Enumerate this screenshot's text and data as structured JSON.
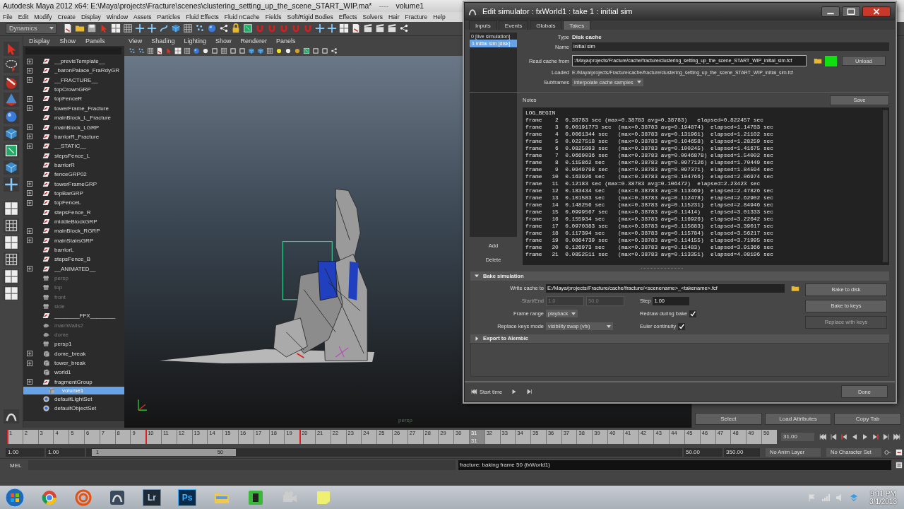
{
  "window": {
    "title": "Autodesk Maya 2012 x64: E:\\Maya\\projects\\Fracture\\scenes\\clustering_setting_up_the_scene_START_WIP.ma*",
    "separator": "----",
    "subtitle": "volume1"
  },
  "menu": [
    "File",
    "Edit",
    "Modify",
    "Create",
    "Display",
    "Window",
    "Assets",
    "Particles",
    "Fluid Effects",
    "Fluid nCache",
    "Fields",
    "Soft/Rigid Bodies",
    "Effects",
    "Solvers",
    "Hair",
    "Fracture",
    "Help"
  ],
  "shelf": {
    "menu_set": "Dynamics"
  },
  "outliner": {
    "menu": [
      "Display",
      "Show",
      "Panels"
    ],
    "items": [
      {
        "name": "__previsTemplate__",
        "kind": "transform",
        "expandable": true,
        "hidden": false,
        "selected": false
      },
      {
        "name": "_baronPalace_FraRdyGR",
        "kind": "transform",
        "expandable": true,
        "hidden": false,
        "selected": false
      },
      {
        "name": "__FRACTURE__",
        "kind": "transform",
        "expandable": true,
        "hidden": false,
        "selected": false
      },
      {
        "name": "topCrownGRP",
        "kind": "transform",
        "expandable": false,
        "hidden": false,
        "selected": false
      },
      {
        "name": "topFenceR",
        "kind": "transform",
        "expandable": true,
        "hidden": false,
        "selected": false
      },
      {
        "name": "towerFrame_Fracture",
        "kind": "transform",
        "expandable": true,
        "hidden": false,
        "selected": false
      },
      {
        "name": "mainBlock_L_Fracture",
        "kind": "transform",
        "expandable": false,
        "hidden": false,
        "selected": false
      },
      {
        "name": "mainBlock_LGRP",
        "kind": "transform",
        "expandable": true,
        "hidden": false,
        "selected": false
      },
      {
        "name": "barriorR_Fracture",
        "kind": "transform",
        "expandable": true,
        "hidden": false,
        "selected": false
      },
      {
        "name": "__STATIC__",
        "kind": "transform",
        "expandable": true,
        "hidden": false,
        "selected": false
      },
      {
        "name": "stepsFence_L",
        "kind": "transform",
        "expandable": false,
        "hidden": false,
        "selected": false
      },
      {
        "name": "barriorR",
        "kind": "transform",
        "expandable": false,
        "hidden": false,
        "selected": false
      },
      {
        "name": "fenceGRP02",
        "kind": "transform",
        "expandable": false,
        "hidden": false,
        "selected": false
      },
      {
        "name": "towerFrameGRP",
        "kind": "transform",
        "expandable": true,
        "hidden": false,
        "selected": false
      },
      {
        "name": "topBarGRP",
        "kind": "transform",
        "expandable": true,
        "hidden": false,
        "selected": false
      },
      {
        "name": "topFenceL",
        "kind": "transform",
        "expandable": true,
        "hidden": false,
        "selected": false
      },
      {
        "name": "stepsFence_R",
        "kind": "transform",
        "expandable": false,
        "hidden": false,
        "selected": false
      },
      {
        "name": "middleBlockGRP",
        "kind": "transform",
        "expandable": false,
        "hidden": false,
        "selected": false
      },
      {
        "name": "mainBlock_RGRP",
        "kind": "transform",
        "expandable": true,
        "hidden": false,
        "selected": false
      },
      {
        "name": "mainStairsGRP",
        "kind": "transform",
        "expandable": true,
        "hidden": false,
        "selected": false
      },
      {
        "name": "barriorL",
        "kind": "transform",
        "expandable": false,
        "hidden": false,
        "selected": false
      },
      {
        "name": "stepsFence_B",
        "kind": "transform",
        "expandable": false,
        "hidden": false,
        "selected": false
      },
      {
        "name": "__ANIMATED__",
        "kind": "transform",
        "expandable": true,
        "hidden": false,
        "selected": false
      },
      {
        "name": "persp",
        "kind": "camera",
        "expandable": false,
        "hidden": true,
        "selected": false
      },
      {
        "name": "top",
        "kind": "camera",
        "expandable": false,
        "hidden": true,
        "selected": false
      },
      {
        "name": "front",
        "kind": "camera",
        "expandable": false,
        "hidden": true,
        "selected": false
      },
      {
        "name": "side",
        "kind": "camera",
        "expandable": false,
        "hidden": true,
        "selected": false
      },
      {
        "name": "________FFX________",
        "kind": "transform",
        "expandable": false,
        "hidden": false,
        "selected": false
      },
      {
        "name": "mainWalls2",
        "kind": "mesh",
        "expandable": false,
        "hidden": true,
        "selected": false
      },
      {
        "name": "dome",
        "kind": "mesh",
        "expandable": false,
        "hidden": true,
        "selected": false
      },
      {
        "name": "persp1",
        "kind": "camera",
        "expandable": false,
        "hidden": false,
        "selected": false
      },
      {
        "name": "dome_break",
        "kind": "group",
        "expandable": true,
        "hidden": false,
        "selected": false
      },
      {
        "name": "tower_break",
        "kind": "group",
        "expandable": true,
        "hidden": false,
        "selected": false
      },
      {
        "name": "world1",
        "kind": "group",
        "expandable": false,
        "hidden": false,
        "selected": false
      },
      {
        "name": "fragmentGroup",
        "kind": "transform",
        "expandable": true,
        "hidden": false,
        "selected": false
      },
      {
        "name": "volume1",
        "kind": "group",
        "expandable": false,
        "hidden": false,
        "selected": true
      },
      {
        "name": "defaultLightSet",
        "kind": "set",
        "expandable": false,
        "hidden": false,
        "selected": false
      },
      {
        "name": "defaultObjectSet",
        "kind": "set",
        "expandable": false,
        "hidden": false,
        "selected": false
      }
    ]
  },
  "viewport": {
    "menu": [
      "View",
      "Shading",
      "Lighting",
      "Show",
      "Renderer",
      "Panels"
    ],
    "camera": "persp"
  },
  "channel_box_buttons": [
    "Select",
    "Load Attributes",
    "Copy Tab"
  ],
  "dialog": {
    "title": "Edit simulator : fxWorld1 : take 1 : initial sim",
    "tabs": [
      {
        "label": "Inputs",
        "selected": false
      },
      {
        "label": "Events",
        "selected": false
      },
      {
        "label": "Globals",
        "selected": false
      },
      {
        "label": "Takes",
        "selected": true
      }
    ],
    "takes": [
      {
        "label": "0 [live simulation]",
        "selected": false
      },
      {
        "label": "1 initial sim [disk]",
        "selected": true
      }
    ],
    "take_buttons": [
      "Add",
      "Delete"
    ],
    "type": {
      "label": "Type",
      "value": "Disk cache"
    },
    "name": {
      "label": "Name",
      "value": "initial sim"
    },
    "read_cache": {
      "label": "Read cache from",
      "value": ":/Maya/projects/Fracture/cache/fracture/clustering_setting_up_the_scene_START_WIP_initial_sim.fcf",
      "loaded": true,
      "unload": "Unload"
    },
    "loaded": {
      "label": "Loaded",
      "value": "E:/Maya/projects/Fracture/cache/fracture/clustering_setting_up_the_scene_START_WIP_initial_sim.fcf"
    },
    "subframes": {
      "label": "Subframes",
      "value": "interpolate cache samples"
    },
    "notes": {
      "label": "Notes",
      "save": "Save",
      "log": [
        "LOG_BEGIN",
        "frame    2  0.38783 sec (max=0.38783 avg=0.38783)   elapsed=0.822457 sec",
        "frame    3  0.00191773 sec  (max=0.38783 avg=0.194874)  elapsed=1.14783 sec",
        "frame    4  0.0061344 sec   (max=0.38783 avg=0.131961)  elapsed=1.21102 sec",
        "frame    5  0.0227518 sec   (max=0.38783 avg=0.104658)  elapsed=1.28259 sec",
        "frame    6  0.0825893 sec   (max=0.38783 avg=0.100245)  elapsed=1.41675 sec",
        "frame    7  0.0669036 sec   (max=0.38783 avg=0.0946878) elapsed=1.54002 sec",
        "frame    8  0.115862 sec    (max=0.38783 avg=0.0977126) elapsed=1.70449 sec",
        "frame    9  0.0949798 sec   (max=0.38783 avg=0.097371)  elapsed=1.84594 sec",
        "frame   10  0.163926 sec    (max=0.38783 avg=0.104766)  elapsed=2.06974 sec",
        "frame   11  0.12183 sec (max=0.38783 avg=0.106472)  elapsed=2.23423 sec",
        "frame   12  0.183434 sec    (max=0.38783 avg=0.113469)  elapsed=2.47826 sec",
        "frame   13  0.101583 sec    (max=0.38783 avg=0.112478)  elapsed=2.62902 sec",
        "frame   14  0.148256 sec    (max=0.38783 avg=0.115231)  elapsed=2.84946 sec",
        "frame   15  0.0999567 sec   (max=0.38783 avg=0.11414)   elapsed=3.01333 sec",
        "frame   16  0.155934 sec    (max=0.38783 avg=0.116926)  elapsed=3.22642 sec",
        "frame   17  0.0970383 sec   (max=0.38783 avg=0.115683)  elapsed=3.39017 sec",
        "frame   18  0.117394 sec    (max=0.38783 avg=0.115784)  elapsed=3.56217 sec",
        "frame   19  0.0864739 sec   (max=0.38783 avg=0.114155)  elapsed=3.71995 sec",
        "frame   20  0.126973 sec    (max=0.38783 avg=0.11483)   elapsed=3.91366 sec",
        "frame   21  0.0852511 sec   (max=0.38783 avg=0.113351)  elapsed=4.08196 sec"
      ]
    },
    "bake": {
      "title": "Bake simulation",
      "expanded": true,
      "write_cache": {
        "label": "Write cache to",
        "value": "E:/Maya/projects/Fracture/cache/fracture/<scenename>_<takename>.fcf"
      },
      "start_end": {
        "label": "Start/End",
        "start": "1.0",
        "end": "50.0",
        "disabled": true
      },
      "step": {
        "label": "Step",
        "value": "1.00"
      },
      "frame_range": {
        "label": "Frame range",
        "value": "playback"
      },
      "redraw": {
        "label": "Redraw during bake",
        "checked": true
      },
      "replace_keys_mode": {
        "label": "Replace keys mode",
        "value": "visibility swap (vfx)"
      },
      "euler": {
        "label": "Euler continuity",
        "checked": true
      },
      "buttons": [
        {
          "label": "Bake to disk",
          "disabled": false
        },
        {
          "label": "Bake to keys",
          "disabled": false
        },
        {
          "label": "Replace with keys",
          "disabled": true
        }
      ]
    },
    "alembic": {
      "title": "Export to Alembic",
      "expanded": false
    },
    "start_time": "Start time",
    "done": "Done"
  },
  "timeline": {
    "frames": [
      {
        "label": "1",
        "key": true,
        "selected": false
      },
      {
        "label": "2",
        "key": false,
        "selected": false
      },
      {
        "label": "3",
        "key": false,
        "selected": false
      },
      {
        "label": "4",
        "key": false,
        "selected": false
      },
      {
        "label": "5",
        "key": false,
        "selected": false
      },
      {
        "label": "6",
        "key": false,
        "selected": false
      },
      {
        "label": "7",
        "key": false,
        "selected": false
      },
      {
        "label": "8",
        "key": false,
        "selected": false
      },
      {
        "label": "9",
        "key": false,
        "selected": false
      },
      {
        "label": "10",
        "key": true,
        "selected": false
      },
      {
        "label": "11",
        "key": false,
        "selected": false
      },
      {
        "label": "12",
        "key": false,
        "selected": false
      },
      {
        "label": "13",
        "key": false,
        "selected": false
      },
      {
        "label": "14",
        "key": false,
        "selected": false
      },
      {
        "label": "15",
        "key": false,
        "selected": false
      },
      {
        "label": "16",
        "key": false,
        "selected": false
      },
      {
        "label": "17",
        "key": false,
        "selected": false
      },
      {
        "label": "18",
        "key": false,
        "selected": false
      },
      {
        "label": "19",
        "key": false,
        "selected": false
      },
      {
        "label": "20",
        "key": true,
        "selected": false
      },
      {
        "label": "21",
        "key": false,
        "selected": false
      },
      {
        "label": "22",
        "key": false,
        "selected": false
      },
      {
        "label": "23",
        "key": false,
        "selected": false
      },
      {
        "label": "24",
        "key": false,
        "selected": false
      },
      {
        "label": "25",
        "key": false,
        "selected": false
      },
      {
        "label": "26",
        "key": false,
        "selected": false
      },
      {
        "label": "27",
        "key": false,
        "selected": false
      },
      {
        "label": "28",
        "key": false,
        "selected": false
      },
      {
        "label": "29",
        "key": false,
        "selected": false
      },
      {
        "label": "30",
        "key": false,
        "selected": false
      },
      {
        "label": "31",
        "key": false,
        "selected": true
      },
      {
        "label": "32",
        "key": false,
        "selected": false
      },
      {
        "label": "33",
        "key": false,
        "selected": false
      },
      {
        "label": "34",
        "key": false,
        "selected": false
      },
      {
        "label": "35",
        "key": false,
        "selected": false
      },
      {
        "label": "36",
        "key": false,
        "selected": false
      },
      {
        "label": "37",
        "key": false,
        "selected": false
      },
      {
        "label": "38",
        "key": false,
        "selected": false
      },
      {
        "label": "39",
        "key": false,
        "selected": false
      },
      {
        "label": "40",
        "key": false,
        "selected": false
      },
      {
        "label": "41",
        "key": false,
        "selected": false
      },
      {
        "label": "42",
        "key": false,
        "selected": false
      },
      {
        "label": "43",
        "key": false,
        "selected": false
      },
      {
        "label": "44",
        "key": false,
        "selected": false
      },
      {
        "label": "45",
        "key": false,
        "selected": false
      },
      {
        "label": "46",
        "key": false,
        "selected": false
      },
      {
        "label": "47",
        "key": false,
        "selected": false
      },
      {
        "label": "48",
        "key": false,
        "selected": false
      },
      {
        "label": "49",
        "key": false,
        "selected": false
      },
      {
        "label": "50",
        "key": false,
        "selected": false
      }
    ],
    "current_frame": "31",
    "current_time": "31.00"
  },
  "range": {
    "start": "1.00",
    "playback_start": "1.00",
    "slider_start": "1",
    "slider_end": "50",
    "playback_end": "50.00",
    "end": "350.00",
    "anim_layer": "No Anim Layer",
    "character_set": "No Character Set"
  },
  "command": {
    "label": "MEL",
    "result": "fracture: baking frame 50 (fxWorld1)"
  },
  "taskbar": {
    "apps": [
      {
        "kind": "browser"
      },
      {
        "kind": "spiral"
      },
      {
        "kind": "maya"
      },
      {
        "kind": "lightroom",
        "label": "Lr"
      },
      {
        "kind": "photoshop",
        "label": "Ps"
      },
      {
        "kind": "folder"
      },
      {
        "kind": "green"
      },
      {
        "kind": "camera"
      },
      {
        "kind": "notes"
      }
    ],
    "time": "9:11 PM",
    "date": "3/1/2013"
  }
}
